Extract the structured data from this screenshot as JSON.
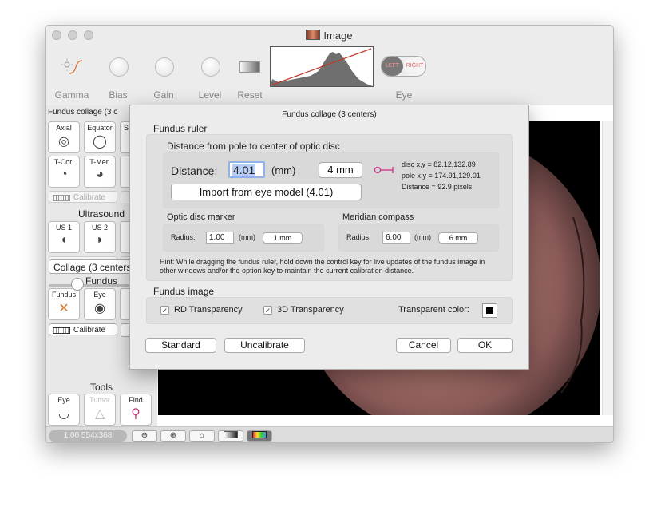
{
  "window": {
    "title": "Image"
  },
  "toolbar": {
    "gamma": "Gamma",
    "bias": "Bias",
    "gain": "Gain",
    "level": "Level",
    "reset": "Reset",
    "eye": "Eye",
    "left": "LEFT",
    "right": "RIGHT"
  },
  "panel": {
    "title": "Fundus collage (3 c",
    "row1": [
      "Axial",
      "Equator",
      "S"
    ],
    "row2": [
      "T-Cor.",
      "T-Mer."
    ],
    "calibrate": "Calibrate",
    "ultrasound": "Ultrasound",
    "us": [
      "US 1",
      "US 2"
    ],
    "fundus": "Fundus",
    "fundus_tools": [
      "Fundus",
      "Eye"
    ],
    "collage": "Collage (3 centers",
    "tools": "Tools",
    "tools_items": [
      "Eye",
      "Tumor",
      "Find"
    ]
  },
  "status": {
    "zoom": "1.00 554x368"
  },
  "dialog": {
    "title": "Fundus collage (3 centers)",
    "ruler_heading": "Fundus ruler",
    "distance_group": "Distance from pole to center of optic disc",
    "distance_label": "Distance:",
    "distance_value": "4.01",
    "distance_unit": "(mm)",
    "distance_button": "4 mm",
    "import_button": "Import from eye model (4.01)",
    "disc_xy": "disc x,y = 82.12,132.89",
    "pole_xy": "pole x,y = 174.91,129.01",
    "distance_px": "Distance = 92.9 pixels",
    "optic_heading": "Optic disc marker",
    "optic_radius_label": "Radius:",
    "optic_radius_value": "1.00",
    "optic_unit": "(mm)",
    "optic_button": "1 mm",
    "meridian_heading": "Meridian compass",
    "meridian_radius_label": "Radius:",
    "meridian_radius_value": "6.00",
    "meridian_unit": "(mm)",
    "meridian_button": "6 mm",
    "hint": "Hint: While dragging the fundus ruler, hold down the control key for live updates of the fundus image in other windows and/or the option key to maintain the current calibration distance.",
    "image_heading": "Fundus image",
    "rd_transparency": "RD Transparency",
    "td_transparency": "3D Transparency",
    "transparent_color": "Transparent color:",
    "transparent_color_value": "#000000",
    "standard": "Standard",
    "uncalibrate": "Uncalibrate",
    "cancel": "Cancel",
    "ok": "OK"
  }
}
